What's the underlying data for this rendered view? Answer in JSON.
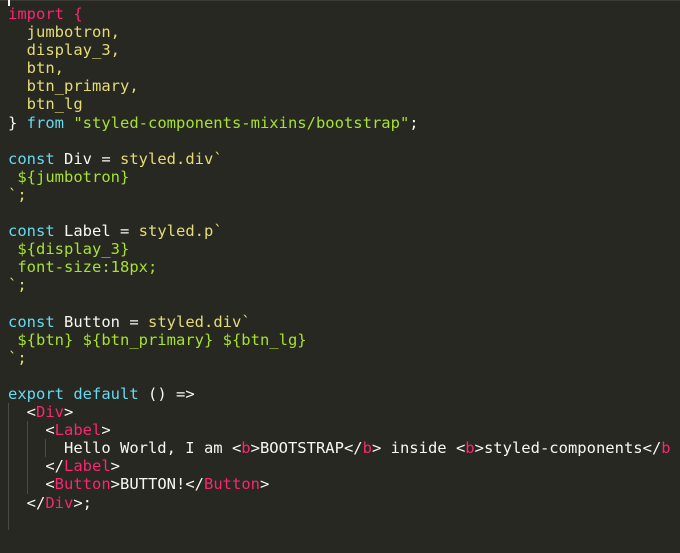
{
  "editor": {
    "lines": [
      [
        {
          "t": "import {",
          "c": "tg"
        }
      ],
      [
        {
          "t": "  jumbotron,",
          "c": "st"
        }
      ],
      [
        {
          "t": "  display_3,",
          "c": "st"
        }
      ],
      [
        {
          "t": "  btn,",
          "c": "st"
        }
      ],
      [
        {
          "t": "  btn_primary,",
          "c": "st"
        }
      ],
      [
        {
          "t": "  btn_lg",
          "c": "st"
        }
      ],
      [
        {
          "t": "} ",
          "c": "w"
        },
        {
          "t": "from",
          "c": "kw"
        },
        {
          "t": " \"styled-components-mixins/bootstrap\"",
          "c": "in"
        },
        {
          "t": ";",
          "c": "w"
        }
      ],
      [],
      [
        {
          "t": "const",
          "c": "kw"
        },
        {
          "t": " Div = ",
          "c": "w"
        },
        {
          "t": "styled.div`",
          "c": "st"
        }
      ],
      [
        {
          "t": " ${jumbotron}",
          "c": "in"
        }
      ],
      [
        {
          "t": "`;",
          "c": "st"
        }
      ],
      [],
      [
        {
          "t": "const",
          "c": "kw"
        },
        {
          "t": " Label = ",
          "c": "w"
        },
        {
          "t": "styled.p`",
          "c": "st"
        }
      ],
      [
        {
          "t": " ${display_3}",
          "c": "in"
        }
      ],
      [
        {
          "t": " font-size:18px;",
          "c": "in"
        }
      ],
      [
        {
          "t": "`;",
          "c": "st"
        }
      ],
      [],
      [
        {
          "t": "const",
          "c": "kw"
        },
        {
          "t": " Button = ",
          "c": "w"
        },
        {
          "t": "styled.div`",
          "c": "st"
        }
      ],
      [
        {
          "t": " ${btn} ${btn_primary} ${btn_lg}",
          "c": "in"
        }
      ],
      [
        {
          "t": "`;",
          "c": "st"
        }
      ],
      [],
      [
        {
          "t": "export",
          "c": "kw"
        },
        {
          "t": " ",
          "c": "w"
        },
        {
          "t": "default",
          "c": "kw"
        },
        {
          "t": " () =>",
          "c": "w"
        }
      ],
      [
        {
          "t": "  <",
          "c": "w"
        },
        {
          "t": "Div",
          "c": "tg"
        },
        {
          "t": ">",
          "c": "w"
        }
      ],
      [
        {
          "t": "    <",
          "c": "w"
        },
        {
          "t": "Label",
          "c": "tg"
        },
        {
          "t": ">",
          "c": "w"
        }
      ],
      [
        {
          "t": "      Hello World, I am <",
          "c": "w"
        },
        {
          "t": "b",
          "c": "tg"
        },
        {
          "t": ">BOOTSTRAP</",
          "c": "w"
        },
        {
          "t": "b",
          "c": "tg"
        },
        {
          "t": "> inside <",
          "c": "w"
        },
        {
          "t": "b",
          "c": "tg"
        },
        {
          "t": ">styled-components</",
          "c": "w"
        },
        {
          "t": "b",
          "c": "tg"
        }
      ],
      [
        {
          "t": "    </",
          "c": "w"
        },
        {
          "t": "Label",
          "c": "tg"
        },
        {
          "t": ">",
          "c": "w"
        }
      ],
      [
        {
          "t": "    <",
          "c": "w"
        },
        {
          "t": "Button",
          "c": "tg"
        },
        {
          "t": ">BUTTON!</",
          "c": "w"
        },
        {
          "t": "Button",
          "c": "tg"
        },
        {
          "t": ">",
          "c": "w"
        }
      ],
      [
        {
          "t": "  </",
          "c": "w"
        },
        {
          "t": "Div",
          "c": "tg"
        },
        {
          "t": ">;",
          "c": "w"
        }
      ],
      []
    ]
  },
  "colors": {
    "background": "#272822",
    "text": "#f8f8f2",
    "keyword": "#66d9ef",
    "string": "#e6db74",
    "interpolation": "#a6e22e",
    "tag": "#f92672"
  }
}
